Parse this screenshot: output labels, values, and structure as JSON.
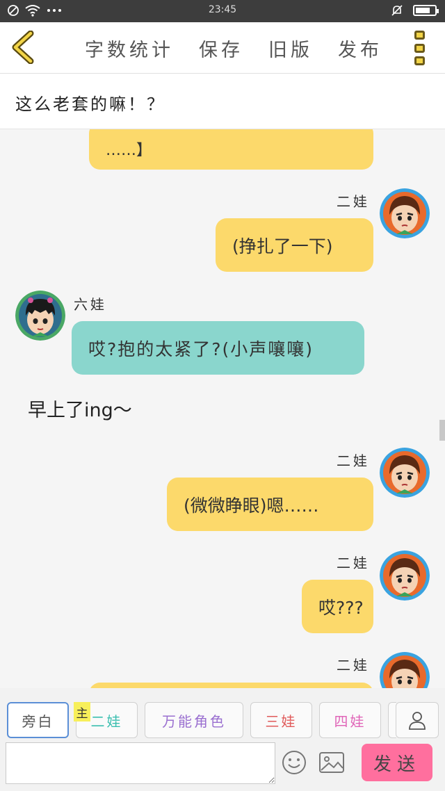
{
  "status": {
    "time": "23:45",
    "battery_level": 0.75,
    "left_icons": [
      "blocked-icon",
      "wifi-icon",
      "more-dots-icon"
    ],
    "right_icons": [
      "silent-bell-icon",
      "battery-icon"
    ]
  },
  "toolbar": {
    "actions": [
      {
        "label": "字数统计"
      },
      {
        "label": "保存"
      },
      {
        "label": "旧版"
      },
      {
        "label": "发布"
      }
    ],
    "accent_color": "#f2d447"
  },
  "title": "这么老套的嘛！？",
  "messages": [
    {
      "speaker": "",
      "text": "……】",
      "side": "right",
      "color": "#fcd96b"
    },
    {
      "speaker": "二娃",
      "text": "(挣扎了一下)",
      "side": "right",
      "color": "#fcd96b"
    },
    {
      "speaker": "六娃",
      "text": "哎?抱的太紧了?(小声嚷嚷)",
      "side": "left",
      "color": "#8ad6cd"
    },
    {
      "narration": "早上了ing～"
    },
    {
      "speaker": "二娃",
      "text": "(微微睁眼)嗯……",
      "side": "right",
      "color": "#fcd96b"
    },
    {
      "speaker": "二娃",
      "text": "哎???",
      "side": "right",
      "color": "#fcd96b"
    },
    {
      "speaker": "二娃",
      "text": "",
      "side": "right",
      "color": "#fcd96b"
    }
  ],
  "roles": [
    {
      "label": "旁白",
      "color": "#555555",
      "active": true
    },
    {
      "label": "二娃",
      "color": "#3bbfb0",
      "tag": "主"
    },
    {
      "label": "万能角色",
      "color": "#9a6fd0"
    },
    {
      "label": "三娃",
      "color": "#e05a5a"
    },
    {
      "label": "四娃",
      "color": "#e066b8"
    }
  ],
  "input": {
    "value": "",
    "placeholder": ""
  },
  "send_label": "发送"
}
